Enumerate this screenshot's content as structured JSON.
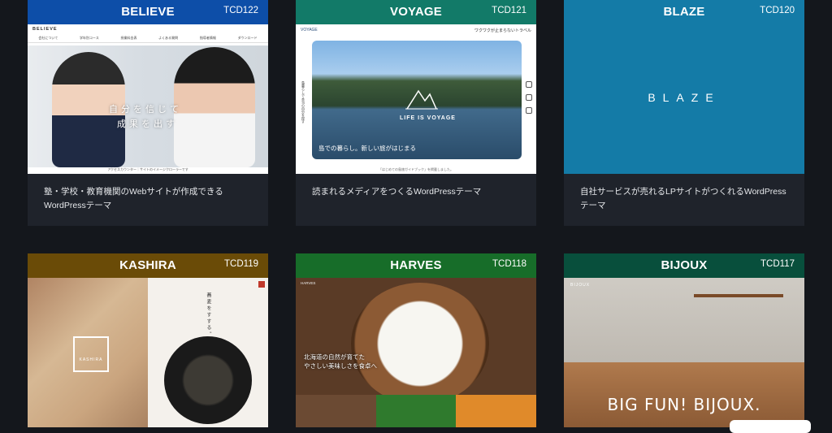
{
  "cards": [
    {
      "name": "BELIEVE",
      "code": "TCD122",
      "desc": "塾・学校・教育機関のWebサイトが作成できるWordPressテーマ",
      "shot": {
        "logo": "BELIEVE",
        "menu": [
          "会社について",
          "学年別コース",
          "授業料金表",
          "よくある質問",
          "指導者情報",
          "ダウンロード"
        ],
        "tagline_1": "自分を信じて",
        "tagline_2": "成果を出す",
        "footer": "アクセスカウンター｜サイトのイメージクローラーです"
      }
    },
    {
      "name": "VOYAGE",
      "code": "TCD121",
      "desc": "読まれるメディアをつくるWordPressテーマ",
      "shot": {
        "logo": "VOYAGE",
        "nav_text": "ワクワクが止まらないトラベル",
        "photo_title": "LIFE IS VOYAGE",
        "caption": "島での暮らし。新しい旅がはじまる",
        "side_text": "島暮らしで本当の自分を探す",
        "footer": "「はじめての島旅ガイドブック」を掲載しました。"
      }
    },
    {
      "name": "BLAZE",
      "code": "TCD120",
      "desc": "自社サービスが売れるLPサイトがつくれるWordPressテーマ",
      "shot": {
        "word": "BLAZE"
      }
    },
    {
      "name": "KASHIRA",
      "code": "TCD119",
      "desc": "",
      "shot": {
        "logo": "KASHIRA",
        "vertical": "蕎麦をすする。"
      }
    },
    {
      "name": "HARVES",
      "code": "TCD118",
      "desc": "",
      "shot": {
        "logo": "HARVES",
        "line1": "北海道の自然が育てた",
        "line2": "やさしい美味しさを食卓へ"
      }
    },
    {
      "name": "BIJOUX",
      "code": "TCD117",
      "desc": "",
      "shot": {
        "logo": "BIJOUX",
        "slogan": "BIG FUN! BIJOUX."
      }
    }
  ],
  "colors": {
    "background": "#14171c",
    "card": "#1f232b",
    "head_believe": "#0d4ea8",
    "head_voyage": "#127a68",
    "head_blaze": "#147ba7",
    "head_kashira": "#6a4b07",
    "head_harves": "#176d29",
    "head_bijoux": "#084f3c"
  }
}
